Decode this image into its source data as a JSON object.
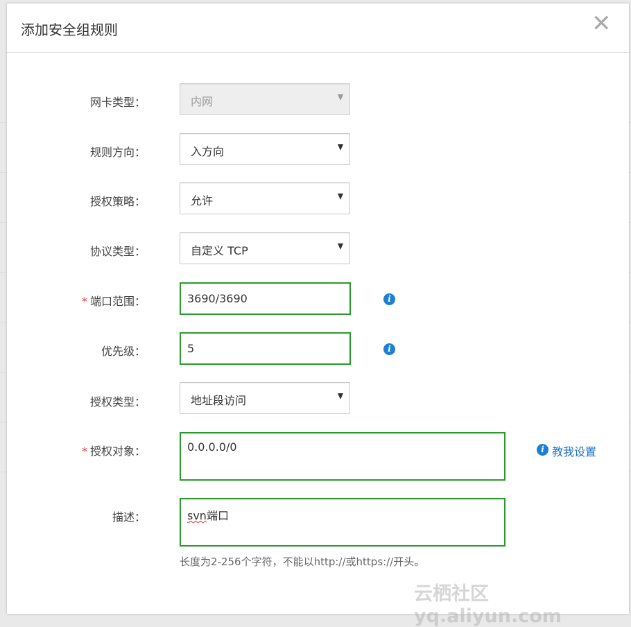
{
  "dialog": {
    "title": "添加安全组规则",
    "close_glyph": "✕"
  },
  "fields": {
    "nic_type": {
      "label": "网卡类型：",
      "value": "内网",
      "disabled": true
    },
    "direction": {
      "label": "规则方向：",
      "value": "入方向"
    },
    "policy": {
      "label": "授权策略：",
      "value": "允许"
    },
    "protocol": {
      "label": "协议类型：",
      "value": "自定义 TCP"
    },
    "port_range": {
      "label": "端口范围：",
      "required": "*",
      "value": "3690/3690"
    },
    "priority": {
      "label": "优先级：",
      "value": "5"
    },
    "auth_type": {
      "label": "授权类型：",
      "value": "地址段访问"
    },
    "auth_object": {
      "label": "授权对象：",
      "required": "*",
      "value": "0.0.0.0/0"
    },
    "description": {
      "label": "描述：",
      "value_misspelled": "svn",
      "value_rest": "端口"
    }
  },
  "help": {
    "link_text": "教我设置",
    "icon": "info-icon"
  },
  "hint_text": "长度为2-256个字符，不能以http://或https://开头。",
  "watermark": "云栖社区 yq.aliyun.com",
  "colors": {
    "focus_border": "#2a9b2a",
    "info_blue": "#1d7fd6",
    "required_red": "#e4393c"
  }
}
